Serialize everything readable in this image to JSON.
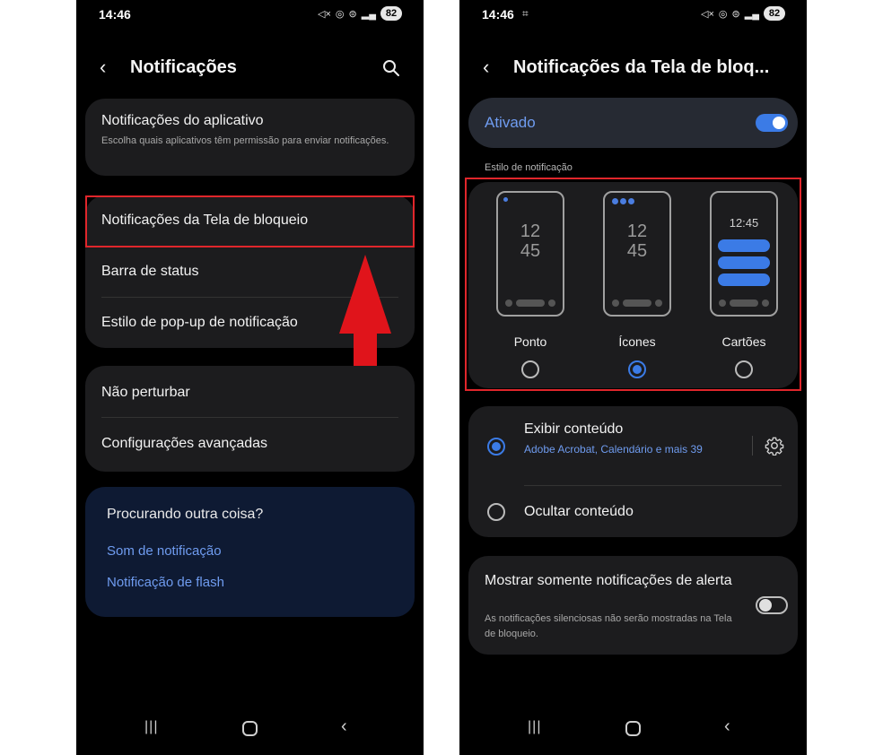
{
  "left_phone": {
    "status": {
      "time": "14:46",
      "battery": "82"
    },
    "header": {
      "title": "Notificações"
    },
    "app_notifications": {
      "title": "Notificações do aplicativo",
      "subtitle": "Escolha quais aplicativos têm permissão para enviar notificações."
    },
    "menu_group": [
      {
        "label": "Notificações da Tela de bloqueio"
      },
      {
        "label": "Barra de status"
      },
      {
        "label": "Estilo de pop-up de notificação"
      }
    ],
    "menu_group2": [
      {
        "label": "Não perturbar"
      },
      {
        "label": "Configurações avançadas"
      }
    ],
    "help": {
      "title": "Procurando outra coisa?",
      "links": [
        "Som de notificação",
        "Notificação de flash"
      ]
    }
  },
  "right_phone": {
    "status": {
      "time": "14:46",
      "battery": "82"
    },
    "header": {
      "title": "Notificações da Tela de bloq..."
    },
    "enabled_toggle": {
      "label": "Ativado",
      "on": true
    },
    "notification_style": {
      "section_label": "Estilo de notificação",
      "options": [
        {
          "name": "Ponto",
          "clock": [
            "12",
            "45"
          ],
          "selected": false
        },
        {
          "name": "Ícones",
          "clock": [
            "12",
            "45"
          ],
          "selected": true
        },
        {
          "name": "Cartões",
          "clock": [
            "12:45"
          ],
          "selected": false
        }
      ]
    },
    "content_options": {
      "show": {
        "title": "Exibir conteúdo",
        "subtitle": "Adobe Acrobat, Calendário e mais 39",
        "selected": true
      },
      "hide": {
        "title": "Ocultar conteúdo",
        "selected": false
      }
    },
    "alert_only": {
      "title": "Mostrar somente notificações de alerta",
      "subtitle": "As notificações silenciosas não serão mostradas na Tela de bloqueio.",
      "on": false
    }
  },
  "colors": {
    "accent_blue": "#3b7be6",
    "link_blue": "#6f9cf0",
    "highlight_red": "#e0262b",
    "arrow_red": "#e0141b",
    "card_bg": "#1c1c1e",
    "help_card_bg": "#0e1a33"
  },
  "icons": [
    "back-icon",
    "search-icon",
    "gear-icon",
    "nav-recent-icon",
    "nav-home-icon",
    "nav-back-icon",
    "up-arrow-icon"
  ]
}
